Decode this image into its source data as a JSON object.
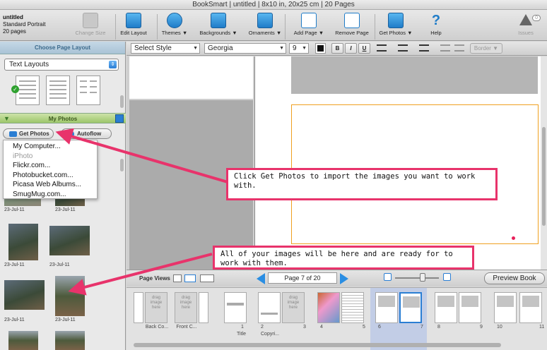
{
  "window": {
    "title": "BookSmart  |  untitled  |  8x10 in, 20x25 cm  |  20 Pages"
  },
  "project": {
    "name": "untitled",
    "style": "Standard Portrait",
    "pages": "20 pages"
  },
  "toolbar": {
    "change_size": "Change Size",
    "edit_layout": "Edit Layout",
    "themes": "Themes ▼",
    "backgrounds": "Backgrounds ▼",
    "ornaments": "Ornaments ▼",
    "add_page": "Add Page ▼",
    "remove_page": "Remove Page",
    "get_photos": "Get Photos ▼",
    "help": "Help",
    "issues": "Issues",
    "issues_count": "0"
  },
  "layout_panel": {
    "title": "Choose Page Layout",
    "selector": "Text Layouts"
  },
  "my_photos": {
    "title": "My Photos",
    "get_photos_button": "Get Photos",
    "autoflow_button": "Autoflow",
    "menu": [
      "My Computer...",
      "iPhoto",
      "Flickr.com...",
      "Photobucket.com...",
      "Picasa Web Albums...",
      "SmugMug.com..."
    ],
    "dates": [
      "23-Jul-11",
      "23-Jul-11",
      "23-Jul-11",
      "23-Jul-11",
      "23-Jul-11",
      "23-Jul-11"
    ]
  },
  "format": {
    "style": "Select Style",
    "font": "Georgia",
    "size": "9",
    "bold": "B",
    "italic": "I",
    "underline": "U",
    "border": "Border ▼"
  },
  "page_views": {
    "label": "Page Views",
    "indicator": "Page 7 of 20",
    "preview": "Preview Book"
  },
  "filmstrip": {
    "drag_text": "drag image here",
    "labels": {
      "back_cover": "Back Co...",
      "front_cover": "Front C...",
      "p1_num": "1",
      "p1_title": "Title",
      "p2_num": "2",
      "p2_title": "Copyri...",
      "p3": "3",
      "p4": "4",
      "p5": "5",
      "p6": "6",
      "p7": "7",
      "p8": "8",
      "p9": "9",
      "p10": "10",
      "p11": "11"
    }
  },
  "annotations": {
    "callout1": "Click Get Photos to import the images you want to work with.",
    "callout2": "All of your images will be here and are ready for to work with them."
  }
}
